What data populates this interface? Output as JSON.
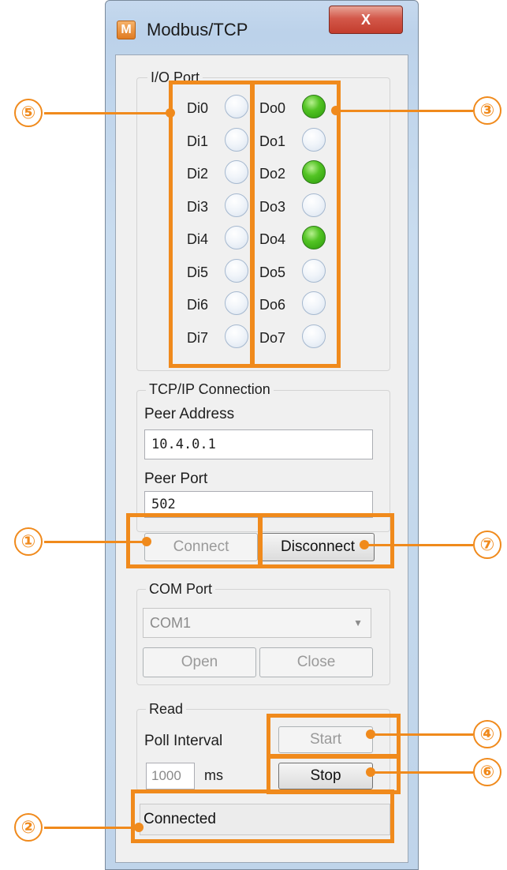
{
  "window": {
    "title": "Modbus/TCP",
    "app_icon": "M",
    "close_glyph": "X"
  },
  "io": {
    "group_label": "I/O Port",
    "di": [
      {
        "label": "Di0",
        "on": false
      },
      {
        "label": "Di1",
        "on": false
      },
      {
        "label": "Di2",
        "on": false
      },
      {
        "label": "Di3",
        "on": false
      },
      {
        "label": "Di4",
        "on": false
      },
      {
        "label": "Di5",
        "on": false
      },
      {
        "label": "Di6",
        "on": false
      },
      {
        "label": "Di7",
        "on": false
      }
    ],
    "do": [
      {
        "label": "Do0",
        "on": true
      },
      {
        "label": "Do1",
        "on": false
      },
      {
        "label": "Do2",
        "on": true
      },
      {
        "label": "Do3",
        "on": false
      },
      {
        "label": "Do4",
        "on": true
      },
      {
        "label": "Do5",
        "on": false
      },
      {
        "label": "Do6",
        "on": false
      },
      {
        "label": "Do7",
        "on": false
      }
    ]
  },
  "tcp": {
    "group_label": "TCP/IP Connection",
    "peer_address_label": "Peer Address",
    "peer_address": "10.4.0.1",
    "peer_port_label": "Peer Port",
    "peer_port": "502",
    "connect_label": "Connect",
    "disconnect_label": "Disconnect"
  },
  "com": {
    "group_label": "COM Port",
    "selected": "COM1",
    "open_label": "Open",
    "close_label": "Close"
  },
  "read": {
    "group_label": "Read",
    "poll_interval_label": "Poll Interval",
    "poll_interval": "1000",
    "unit": "ms",
    "start_label": "Start",
    "stop_label": "Stop"
  },
  "status": {
    "text": "Connected"
  },
  "annotations": {
    "1": "①",
    "2": "②",
    "3": "③",
    "4": "④",
    "5": "⑤",
    "6": "⑥",
    "7": "⑦"
  },
  "colors": {
    "accent": "#f08a1c",
    "led_on": "#3cae14",
    "led_off": "#e8eef6"
  }
}
